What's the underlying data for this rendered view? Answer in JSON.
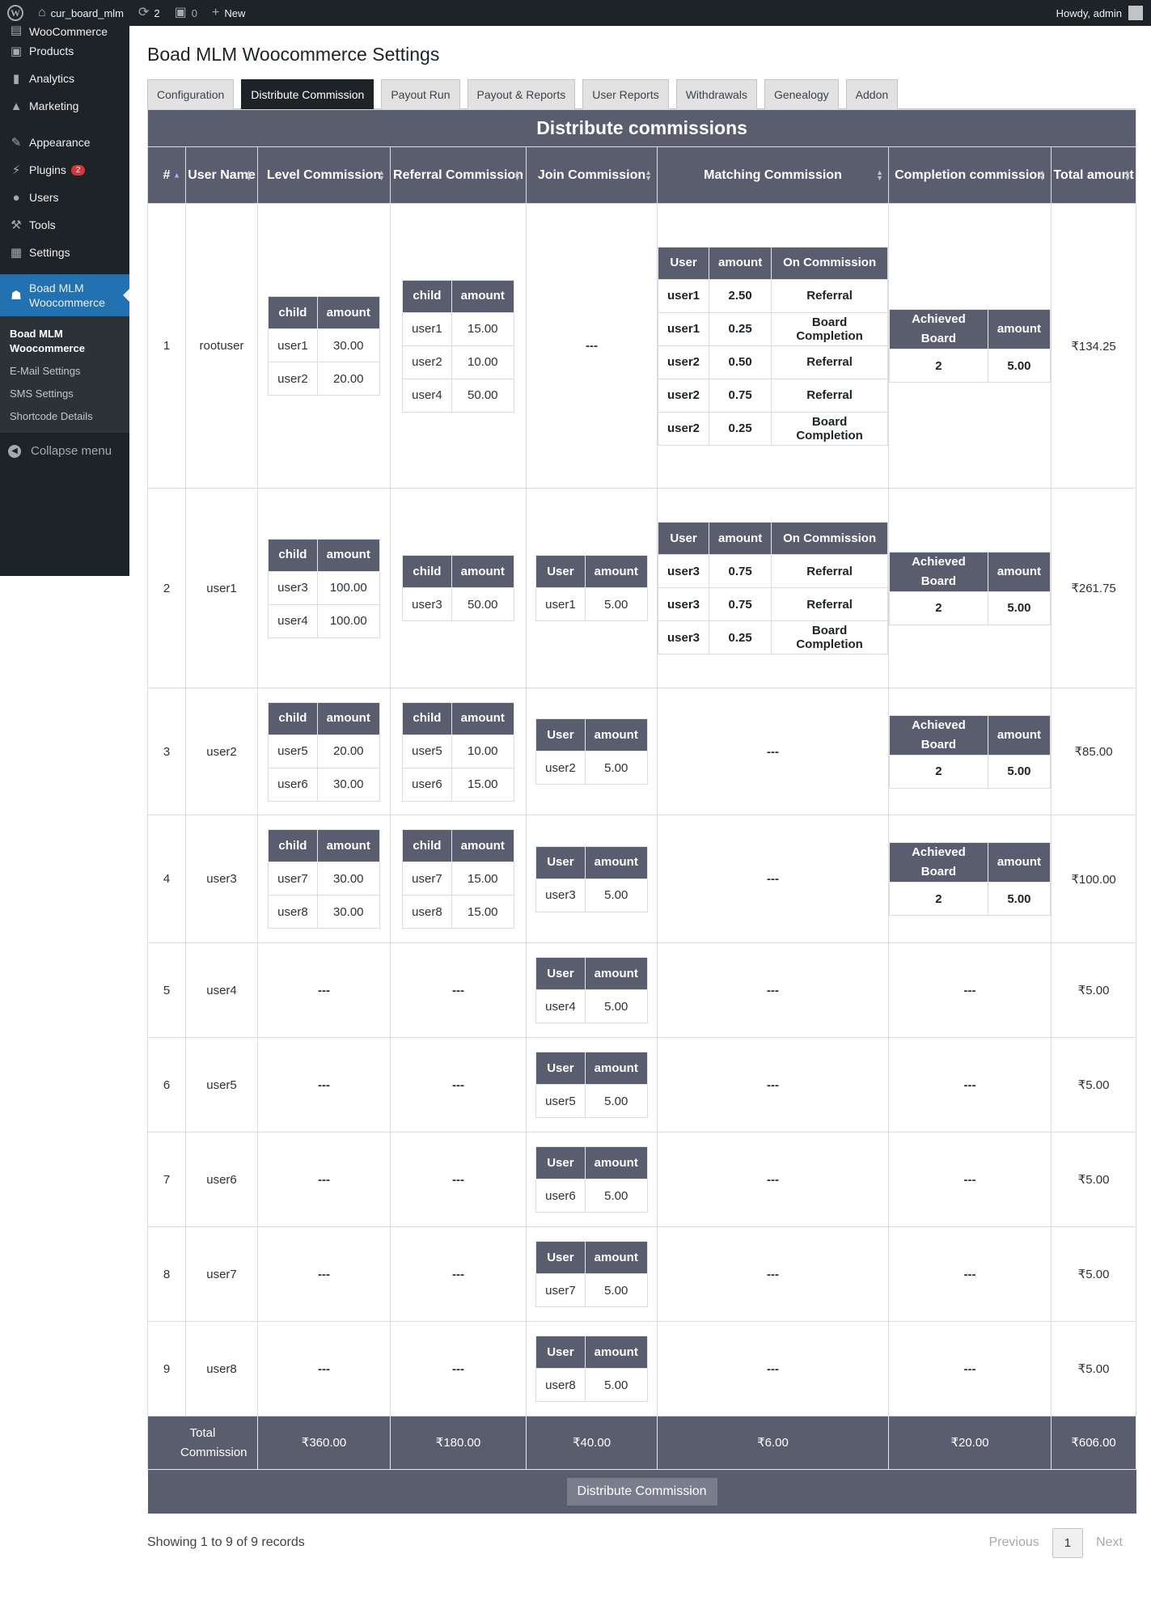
{
  "admin_bar": {
    "site_name": "cur_board_mlm",
    "updates": "2",
    "comments": "0",
    "new_label": "New",
    "greeting": "Howdy, admin"
  },
  "sidebar": {
    "items": [
      {
        "label": "WooCommerce",
        "icon": "woo-icon"
      },
      {
        "label": "Products",
        "icon": "products-icon"
      },
      {
        "label": "Analytics",
        "icon": "analytics-icon"
      },
      {
        "label": "Marketing",
        "icon": "marketing-icon"
      },
      {
        "label": "Appearance",
        "icon": "appearance-icon"
      },
      {
        "label": "Plugins",
        "icon": "plugins-icon",
        "badge": "2"
      },
      {
        "label": "Users",
        "icon": "users-icon"
      },
      {
        "label": "Tools",
        "icon": "tools-icon"
      },
      {
        "label": "Settings",
        "icon": "settings-icon"
      }
    ],
    "current": {
      "label_line1": "Boad MLM",
      "label_line2": "Woocommerce"
    },
    "submenu": [
      "Boad MLM Woocommerce",
      "E-Mail Settings",
      "SMS Settings",
      "Shortcode Details"
    ],
    "collapse_label": "Collapse menu"
  },
  "page": {
    "title": "Boad MLM Woocommerce Settings",
    "tabs": [
      "Configuration",
      "Distribute Commission",
      "Payout Run",
      "Payout & Reports",
      "User Reports",
      "Withdrawals",
      "Genealogy",
      "Addon"
    ],
    "active_tab": "Distribute Commission"
  },
  "table": {
    "banner": "Distribute commissions",
    "headers": {
      "num": "#",
      "user_name": "User Name",
      "level": "Level Commission",
      "referral": "Referral Commission",
      "join": "Join Commission",
      "matching": "Matching Commission",
      "completion": "Completion commission",
      "total": "Total amount"
    },
    "sub_headers": {
      "child": "child",
      "amount": "amount",
      "user": "User",
      "on_commission": "On Commission",
      "achieved_board": "Achieved Board"
    },
    "empty": "---",
    "rows": [
      {
        "num": "1",
        "user": "rootuser",
        "level": [
          [
            "user1",
            "30.00"
          ],
          [
            "user2",
            "20.00"
          ]
        ],
        "referral": [
          [
            "user1",
            "15.00"
          ],
          [
            "user2",
            "10.00"
          ],
          [
            "user4",
            "50.00"
          ]
        ],
        "join": null,
        "matching": [
          [
            "user1",
            "2.50",
            "Referral"
          ],
          [
            "user1",
            "0.25",
            "Board Completion"
          ],
          [
            "user2",
            "0.50",
            "Referral"
          ],
          [
            "user2",
            "0.75",
            "Referral"
          ],
          [
            "user2",
            "0.25",
            "Board Completion"
          ]
        ],
        "completion": [
          [
            "2",
            "5.00"
          ]
        ],
        "total": "₹134.25"
      },
      {
        "num": "2",
        "user": "user1",
        "level": [
          [
            "user3",
            "100.00"
          ],
          [
            "user4",
            "100.00"
          ]
        ],
        "referral": [
          [
            "user3",
            "50.00"
          ]
        ],
        "join": [
          [
            "user1",
            "5.00"
          ]
        ],
        "matching": [
          [
            "user3",
            "0.75",
            "Referral"
          ],
          [
            "user3",
            "0.75",
            "Referral"
          ],
          [
            "user3",
            "0.25",
            "Board Completion"
          ]
        ],
        "completion": [
          [
            "2",
            "5.00"
          ]
        ],
        "total": "₹261.75"
      },
      {
        "num": "3",
        "user": "user2",
        "level": [
          [
            "user5",
            "20.00"
          ],
          [
            "user6",
            "30.00"
          ]
        ],
        "referral": [
          [
            "user5",
            "10.00"
          ],
          [
            "user6",
            "15.00"
          ]
        ],
        "join": [
          [
            "user2",
            "5.00"
          ]
        ],
        "matching": null,
        "completion": [
          [
            "2",
            "5.00"
          ]
        ],
        "total": "₹85.00"
      },
      {
        "num": "4",
        "user": "user3",
        "level": [
          [
            "user7",
            "30.00"
          ],
          [
            "user8",
            "30.00"
          ]
        ],
        "referral": [
          [
            "user7",
            "15.00"
          ],
          [
            "user8",
            "15.00"
          ]
        ],
        "join": [
          [
            "user3",
            "5.00"
          ]
        ],
        "matching": null,
        "completion": [
          [
            "2",
            "5.00"
          ]
        ],
        "total": "₹100.00"
      },
      {
        "num": "5",
        "user": "user4",
        "level": null,
        "referral": null,
        "join": [
          [
            "user4",
            "5.00"
          ]
        ],
        "matching": null,
        "completion": null,
        "total": "₹5.00"
      },
      {
        "num": "6",
        "user": "user5",
        "level": null,
        "referral": null,
        "join": [
          [
            "user5",
            "5.00"
          ]
        ],
        "matching": null,
        "completion": null,
        "total": "₹5.00"
      },
      {
        "num": "7",
        "user": "user6",
        "level": null,
        "referral": null,
        "join": [
          [
            "user6",
            "5.00"
          ]
        ],
        "matching": null,
        "completion": null,
        "total": "₹5.00"
      },
      {
        "num": "8",
        "user": "user7",
        "level": null,
        "referral": null,
        "join": [
          [
            "user7",
            "5.00"
          ]
        ],
        "matching": null,
        "completion": null,
        "total": "₹5.00"
      },
      {
        "num": "9",
        "user": "user8",
        "level": null,
        "referral": null,
        "join": [
          [
            "user8",
            "5.00"
          ]
        ],
        "matching": null,
        "completion": null,
        "total": "₹5.00"
      }
    ],
    "footer": {
      "label": "Total Commission",
      "level": "₹360.00",
      "referral": "₹180.00",
      "join": "₹40.00",
      "matching": "₹6.00",
      "completion": "₹20.00",
      "total": "₹606.00"
    },
    "distribute_button": "Distribute Commission"
  },
  "pagination": {
    "info": "Showing 1 to 9 of 9 records",
    "previous": "Previous",
    "page": "1",
    "next": "Next"
  }
}
